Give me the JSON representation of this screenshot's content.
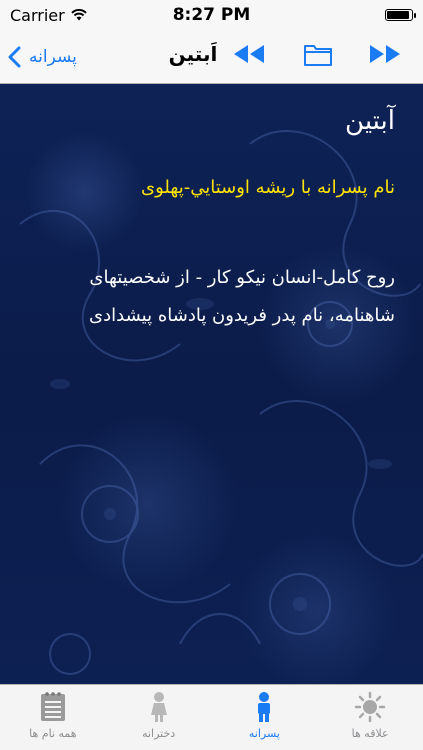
{
  "status_bar": {
    "carrier": "Carrier",
    "time": "8:27 PM"
  },
  "nav": {
    "back_label": "پسرانه",
    "title": "اَبتین"
  },
  "content": {
    "name": "آبتین",
    "origin": "نام پسرانه با ریشه اوستايي-پهلوی",
    "meaning": "روح کامل-انسان نیکو کار - از شخصیتهای شاهنامه، نام پدر فریدون پادشاه پیشدادی",
    "colors": {
      "name": "#ffffff",
      "origin": "#ffe300",
      "meaning": "#ffffff",
      "background": "#0d1f4f"
    }
  },
  "tabs": [
    {
      "label": "همه نام ها",
      "icon": "notepad-icon",
      "active": false
    },
    {
      "label": "دخترانه",
      "icon": "girl-icon",
      "active": false
    },
    {
      "label": "پسرانه",
      "icon": "boy-icon",
      "active": true
    },
    {
      "label": "علاقه ها",
      "icon": "sun-icon",
      "active": false
    }
  ],
  "accent_color": "#1a7bf2"
}
